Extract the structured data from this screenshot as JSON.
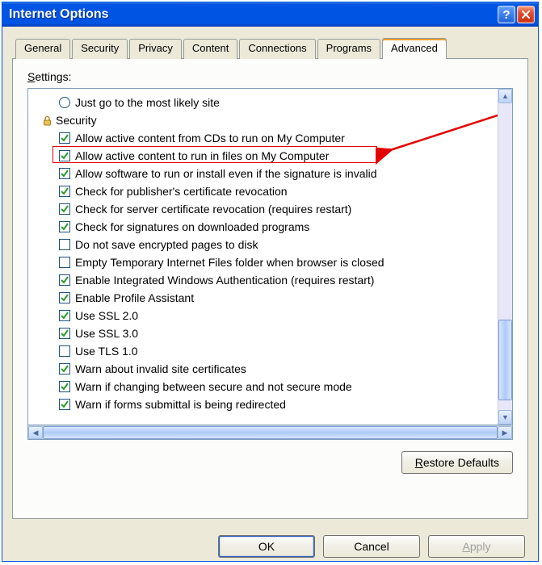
{
  "window": {
    "title": "Internet Options"
  },
  "tabs": [
    {
      "label": "General"
    },
    {
      "label": "Security"
    },
    {
      "label": "Privacy"
    },
    {
      "label": "Content"
    },
    {
      "label": "Connections"
    },
    {
      "label": "Programs"
    },
    {
      "label": "Advanced"
    }
  ],
  "active_tab_index": 6,
  "settings_label": "Settings:",
  "restore_label": "Restore Defaults",
  "ok_label": "OK",
  "cancel_label": "Cancel",
  "apply_label": "Apply",
  "category_label": "Security",
  "radio_item": {
    "label": "Just go to the most likely site"
  },
  "items": [
    {
      "checked": true,
      "label": "Allow active content from CDs to run on My Computer"
    },
    {
      "checked": true,
      "label": "Allow active content to run in files on My Computer"
    },
    {
      "checked": true,
      "label": "Allow software to run or install even if the signature is invalid"
    },
    {
      "checked": true,
      "label": "Check for publisher's certificate revocation"
    },
    {
      "checked": true,
      "label": "Check for server certificate revocation (requires restart)"
    },
    {
      "checked": true,
      "label": "Check for signatures on downloaded programs"
    },
    {
      "checked": false,
      "label": "Do not save encrypted pages to disk"
    },
    {
      "checked": false,
      "label": "Empty Temporary Internet Files folder when browser is closed"
    },
    {
      "checked": true,
      "label": "Enable Integrated Windows Authentication (requires restart)"
    },
    {
      "checked": true,
      "label": "Enable Profile Assistant"
    },
    {
      "checked": true,
      "label": "Use SSL 2.0"
    },
    {
      "checked": true,
      "label": "Use SSL 3.0"
    },
    {
      "checked": false,
      "label": "Use TLS 1.0"
    },
    {
      "checked": true,
      "label": "Warn about invalid site certificates"
    },
    {
      "checked": true,
      "label": "Warn if changing between secure and not secure mode"
    },
    {
      "checked": true,
      "label": "Warn if forms submittal is being redirected"
    }
  ],
  "highlight_index": 1
}
